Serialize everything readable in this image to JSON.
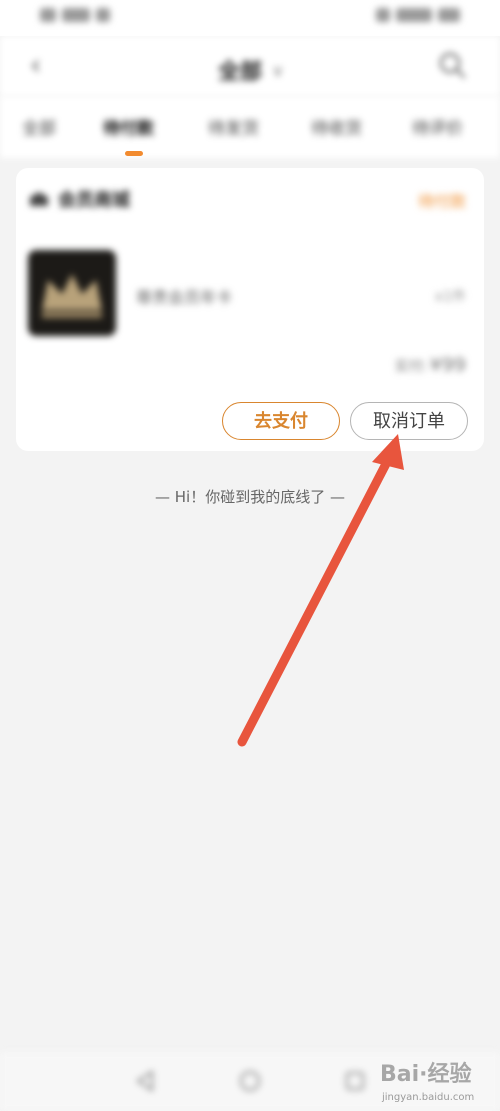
{
  "status_bar": {
    "left_text": "■ 5G ░",
    "right_text": "■ ▒▒ 100"
  },
  "header": {
    "title": "全部",
    "caret": "∨"
  },
  "tabs": [
    {
      "label": "全部"
    },
    {
      "label": "待付款"
    },
    {
      "label": "待发货"
    },
    {
      "label": "待收货"
    },
    {
      "label": "待评价"
    }
  ],
  "order": {
    "shop_name": "会员商城",
    "status": "待付款",
    "product_name": "尊贵会员年卡",
    "quantity": "x1件",
    "price_label": "实付:",
    "price_value": "¥99",
    "pay_button": "去支付",
    "cancel_button": "取消订单"
  },
  "list_end_text": "— Hi！你碰到我的底线了 —",
  "watermark": {
    "brand": "Bai·经验",
    "url": "jingyan.baidu.com"
  },
  "colors": {
    "accent": "#f0943a",
    "pay_border": "#d9862f",
    "arrow": "#e8553d",
    "background": "#f3f3f3"
  }
}
